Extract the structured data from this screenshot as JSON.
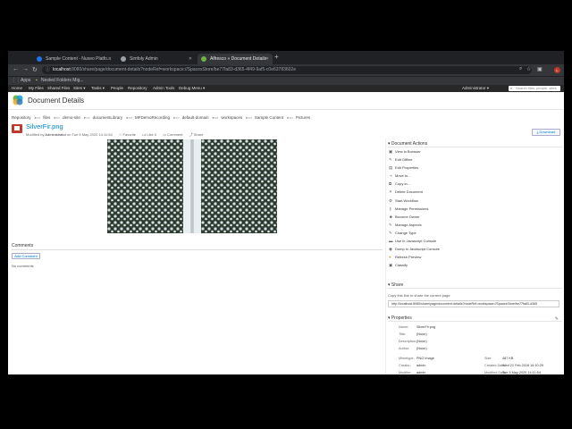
{
  "browser": {
    "tabs": [
      {
        "title": "Sample Content - Nuxeo Platfo..."
      },
      {
        "title": "Simfoly Admin"
      },
      {
        "title": "Alfresco » Document Details"
      }
    ],
    "url_host": "localhost",
    "url_path": ":8080/share/page/document-details?nodeRef=workspace://SpacesStore/be77fa83-d365-4f49-9af5-c0e63783602e",
    "bookmarks": [
      {
        "label": "Apps"
      },
      {
        "label": "Nested Folders Mig..."
      }
    ],
    "avatar_letter": "L"
  },
  "app_menu": {
    "items": [
      "Home",
      "My Files",
      "Shared Files",
      "Sites ▾",
      "Tasks ▾",
      "People",
      "Repository",
      "Admin Tools",
      "Debug Menu ▾"
    ],
    "user": "Administrator ▾",
    "search_placeholder": "Search files, people, sites"
  },
  "page": {
    "title": "Document Details",
    "breadcrumb": [
      "Repository",
      "files",
      "demo-site",
      "documentLibrary",
      "MFDemoRecording",
      "default-domain",
      "workspaces",
      "Sample Content",
      "Pictures"
    ]
  },
  "document": {
    "name": "SilverFir.png",
    "modified_prefix": "Modified by",
    "modifier": "Administrator",
    "modified_on": "on Tue 5 May 2020 14:11:54",
    "favorite": "Favorite",
    "like": "Like",
    "like_count": "0",
    "comment": "Comment",
    "share": "Share",
    "download": "Download"
  },
  "comments": {
    "title": "Comments",
    "add_button": "Add Comment",
    "empty": "No comments"
  },
  "actions_panel": {
    "title": "Document Actions",
    "items": [
      {
        "label": "View in Browser",
        "icon": "view-icon"
      },
      {
        "label": "Edit Offline",
        "icon": "edit-icon"
      },
      {
        "label": "Edit Properties",
        "icon": "properties-icon"
      },
      {
        "label": "Move to...",
        "icon": "move-icon"
      },
      {
        "label": "Copy to...",
        "icon": "copy-icon"
      },
      {
        "label": "Delete Document",
        "icon": "delete-icon"
      },
      {
        "label": "Start Workflow",
        "icon": "workflow-icon"
      },
      {
        "label": "Manage Permissions",
        "icon": "permissions-icon"
      },
      {
        "label": "Become Owner",
        "icon": "owner-icon"
      },
      {
        "label": "Manage Aspects",
        "icon": "aspects-icon"
      },
      {
        "label": "Change Type",
        "icon": "type-icon"
      },
      {
        "label": "Use in Javascript Console",
        "icon": "console-icon"
      },
      {
        "label": "Dump in Javascript Console",
        "icon": "dump-icon"
      },
      {
        "label": "Refresh Preview",
        "icon": "refresh-icon"
      },
      {
        "label": "Classify",
        "icon": "classify-icon"
      }
    ]
  },
  "share_panel": {
    "title": "Share",
    "label": "Copy this link to share the current page",
    "url": "http://localhost:8080/share/page/document-details?nodeRef=workspace://SpacesStore/be77fa83-d365"
  },
  "properties": {
    "title": "Properties",
    "left": [
      {
        "k": "Name:",
        "v": "SilverFir.png"
      },
      {
        "k": "Title:",
        "v": "(None)"
      },
      {
        "k": "Description:",
        "v": "(None)"
      },
      {
        "k": "Author:",
        "v": "(None)"
      },
      {
        "k": "Mimetype:",
        "v": "PNG Image"
      },
      {
        "k": "Creator:",
        "v": "admin"
      },
      {
        "k": "Modifier:",
        "v": "admin"
      }
    ],
    "right": [
      {
        "k": "Size:",
        "v": "487 KB"
      },
      {
        "k": "Created Date:",
        "v": "Wed 21 Feb 2018 16:10:29"
      },
      {
        "k": "Modified Date:",
        "v": "Tue 5 May 2020 14:11:54"
      }
    ]
  }
}
